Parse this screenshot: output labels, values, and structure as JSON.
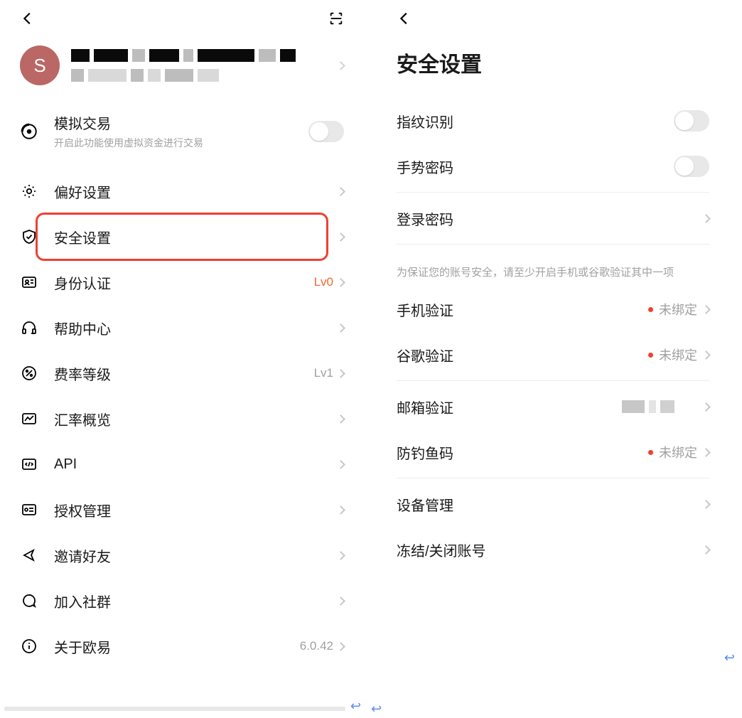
{
  "left": {
    "avatar_letter": "S",
    "sim": {
      "title": "模拟交易",
      "subtitle": "开启此功能使用虚拟资金进行交易"
    },
    "items": {
      "preferences": {
        "label": "偏好设置"
      },
      "security": {
        "label": "安全设置"
      },
      "identity": {
        "label": "身份认证",
        "value": "Lv0"
      },
      "help": {
        "label": "帮助中心"
      },
      "fee": {
        "label": "费率等级",
        "value": "Lv1"
      },
      "fx": {
        "label": "汇率概览"
      },
      "api": {
        "label": "API"
      },
      "auth": {
        "label": "授权管理"
      },
      "invite": {
        "label": "邀请好友"
      },
      "community": {
        "label": "加入社群"
      },
      "about": {
        "label": "关于欧易",
        "value": "6.0.42"
      }
    }
  },
  "right": {
    "title": "安全设置",
    "items": {
      "fingerprint": {
        "label": "指纹识别"
      },
      "gesture": {
        "label": "手势密码"
      },
      "loginpwd": {
        "label": "登录密码"
      },
      "hint": "为保证您的账号安全，请至少开启手机或谷歌验证其中一项",
      "phone": {
        "label": "手机验证",
        "value": "未绑定"
      },
      "google": {
        "label": "谷歌验证",
        "value": "未绑定"
      },
      "email": {
        "label": "邮箱验证"
      },
      "antiphish": {
        "label": "防钓鱼码",
        "value": "未绑定"
      },
      "devices": {
        "label": "设备管理"
      },
      "close": {
        "label": "冻结/关闭账号"
      }
    }
  }
}
